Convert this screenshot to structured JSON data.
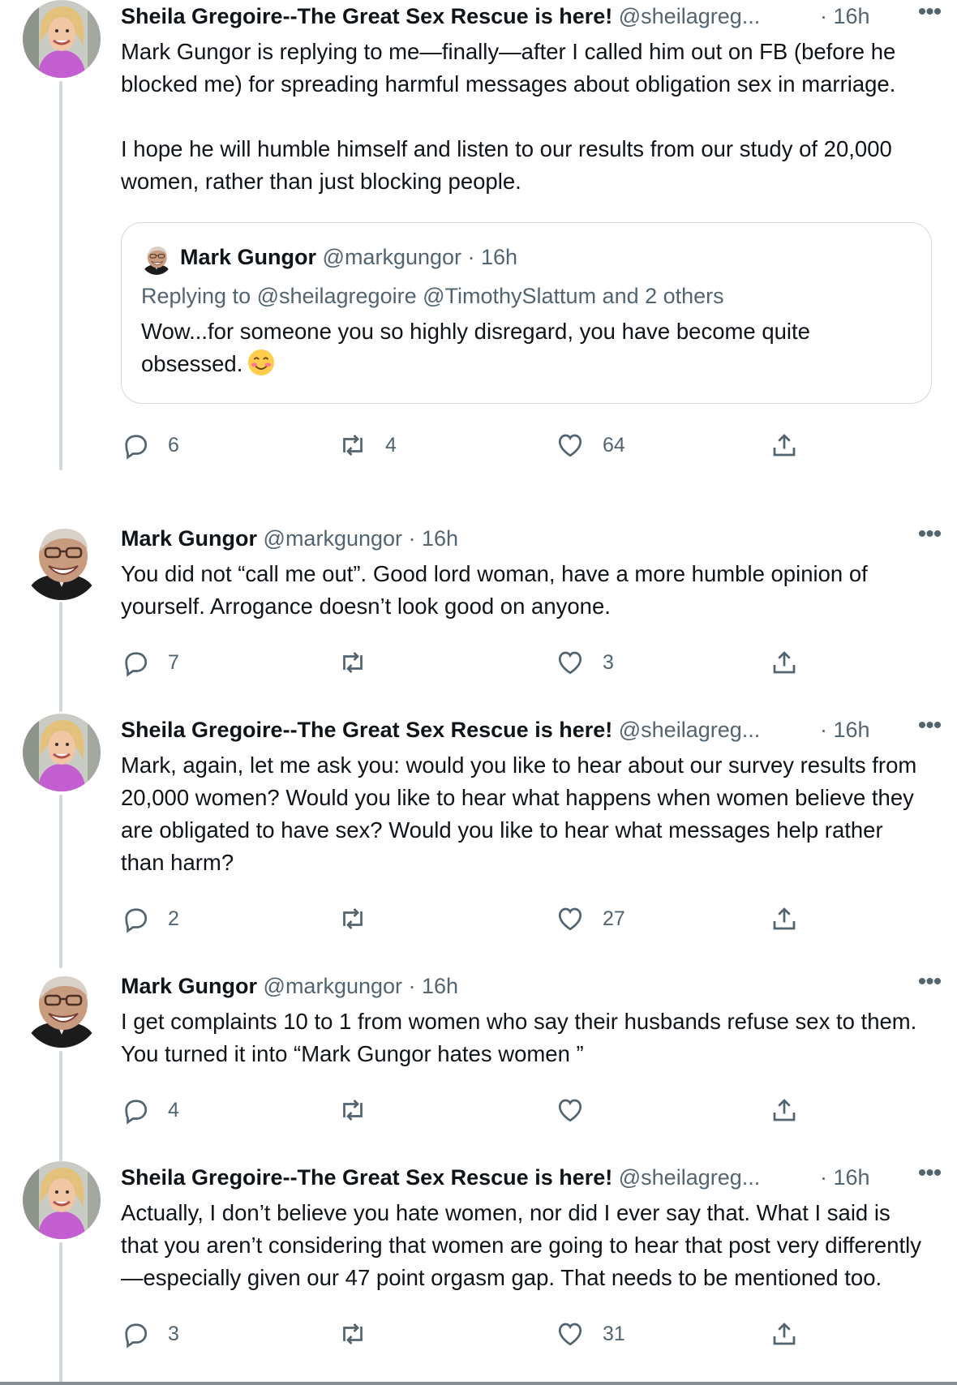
{
  "tweets": [
    {
      "author": "sheila",
      "name": "Sheila Gregoire--The Great Sex Rescue is here!",
      "handle": "@sheilagreg...",
      "time": "· 16h",
      "text": "Mark Gungor is replying to me—finally—after I called him out on FB (before he blocked me) for spreading harmful messages about obligation sex in marriage.\n\nI hope he will humble himself and listen to our results from our study of 20,000 women, rather than just blocking people.",
      "quote": {
        "name": "Mark Gungor",
        "handle": "@markgungor · 16h",
        "replying": "Replying to @sheilagregoire @TimothySlattum and 2 others",
        "text": "Wow...for someone you so highly disregard, you have become quite obsessed."
      },
      "replies": "6",
      "retweets": "4",
      "likes": "64"
    },
    {
      "author": "mark",
      "name": "Mark Gungor",
      "handle": "@markgungor · 16h",
      "time": "",
      "text": "You did not “call me out”. Good lord woman, have a more humble opinion of yourself. Arrogance doesn’t look good on anyone.",
      "replies": "7",
      "retweets": "",
      "likes": "3"
    },
    {
      "author": "sheila",
      "name": "Sheila Gregoire--The Great Sex Rescue is here!",
      "handle": "@sheilagreg...",
      "time": "· 16h",
      "text": "Mark, again, let me ask you: would you like to hear about our survey results from 20,000 women? Would you like to hear what happens when women believe they are obligated to have sex? Would you like to hear what messages help rather than harm?",
      "replies": "2",
      "retweets": "",
      "likes": "27"
    },
    {
      "author": "mark",
      "name": "Mark Gungor",
      "handle": "@markgungor · 16h",
      "time": "",
      "text": "I get complaints 10 to 1 from women who say their husbands refuse sex to them. You turned it into “Mark Gungor hates women ”",
      "replies": "4",
      "retweets": "",
      "likes": ""
    },
    {
      "author": "sheila",
      "name": "Sheila Gregoire--The Great Sex Rescue is here!",
      "handle": "@sheilagreg...",
      "time": "· 16h",
      "text": "Actually, I don’t believe you hate women, nor did I ever say that. What I said is that you aren’t considering that women are going to hear that post very differently—especially given our 47 point orgasm gap. That needs to be mentioned too.",
      "replies": "3",
      "retweets": "",
      "likes": "31"
    }
  ],
  "colors": {
    "text": "#0f1419",
    "secondary": "#536471",
    "border": "#cfd9de"
  },
  "icons": [
    "reply-icon",
    "retweet-icon",
    "like-icon",
    "share-icon",
    "more-icon",
    "smiling-face-emoji"
  ]
}
